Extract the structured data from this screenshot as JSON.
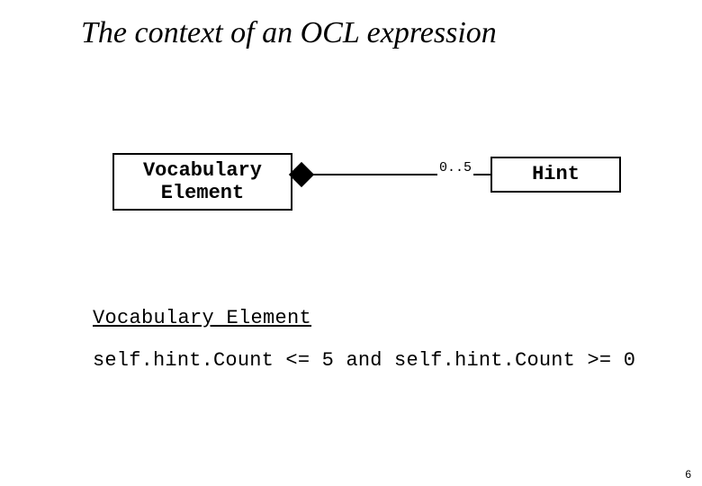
{
  "title": "The context of an OCL expression",
  "diagram": {
    "left_box": "Vocabulary\nElement",
    "right_box": "Hint",
    "multiplicity": "0..5"
  },
  "ocl": {
    "context": "Vocabulary Element",
    "constraint": "self.hint.Count <= 5 and self.hint.Count >= 0"
  },
  "page_number": "6"
}
